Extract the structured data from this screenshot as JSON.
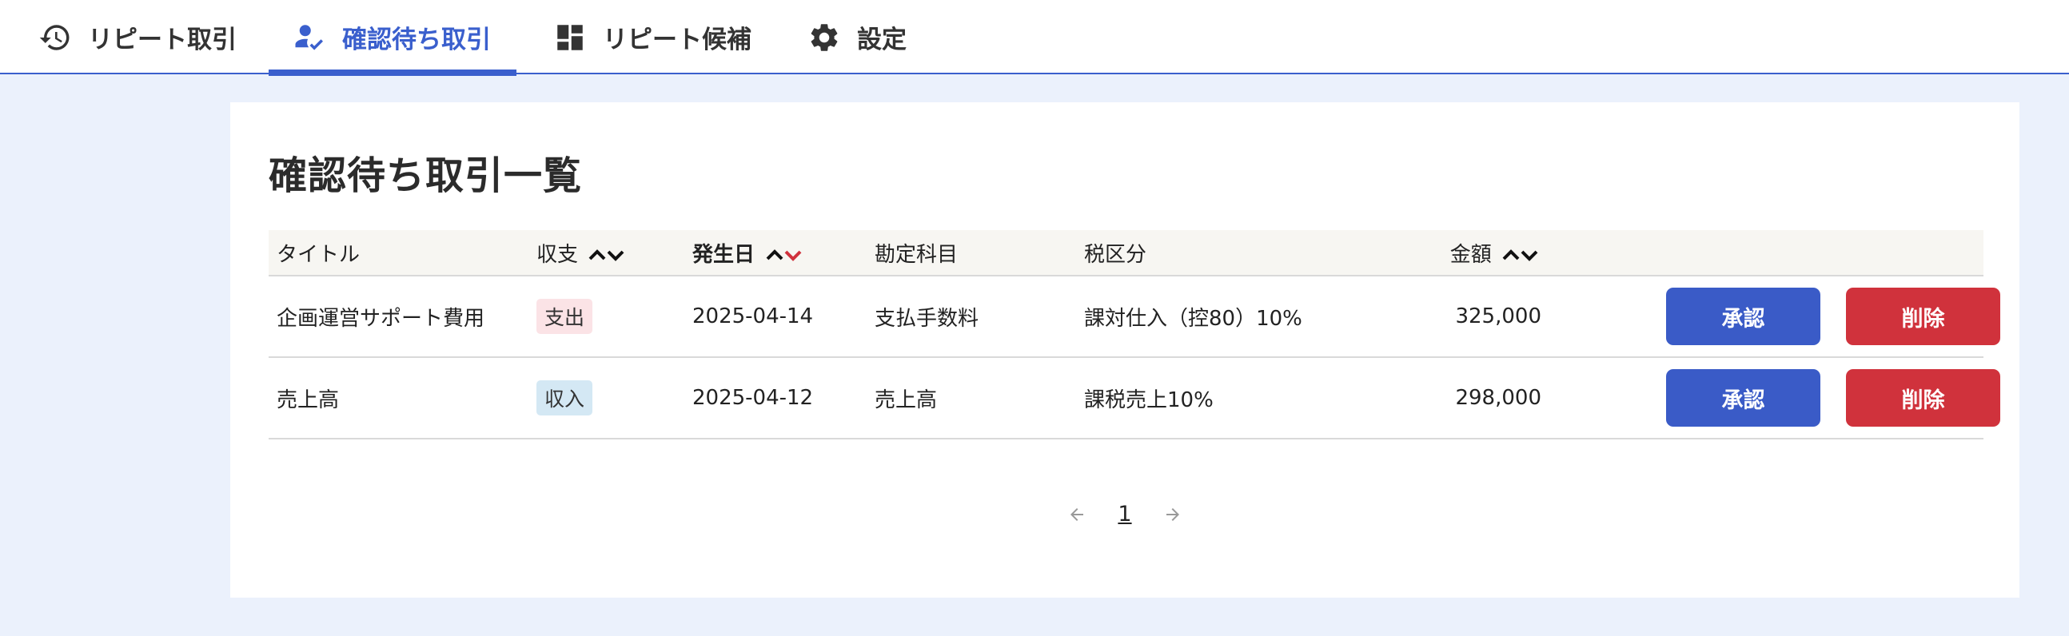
{
  "tabs": [
    {
      "label": "リピート取引",
      "icon": "history-icon",
      "active": false
    },
    {
      "label": "確認待ち取引",
      "icon": "user-check-icon",
      "active": true
    },
    {
      "label": "リピート候補",
      "icon": "dashboard-icon",
      "active": false
    },
    {
      "label": "設定",
      "icon": "gear-icon",
      "active": false
    }
  ],
  "page": {
    "title": "確認待ち取引一覧"
  },
  "table": {
    "headers": {
      "title": "タイトル",
      "type": "収支",
      "date": "発生日",
      "account": "勘定科目",
      "tax": "税区分",
      "amount": "金額"
    },
    "sorted_column": "発生日",
    "sorted_direction": "descending",
    "rows": [
      {
        "title": "企画運営サポート費用",
        "type": "支出",
        "date": "2025-04-14",
        "account": "支払手数料",
        "tax": "課対仕入（控80）10%",
        "amount": "325,000"
      },
      {
        "title": "売上高",
        "type": "収入",
        "date": "2025-04-12",
        "account": "売上高",
        "tax": "課税売上10%",
        "amount": "298,000"
      }
    ],
    "approve_label": "承認",
    "delete_label": "削除"
  },
  "pagination": {
    "current": "1"
  },
  "colors": {
    "accent": "#3a5fcd",
    "approve": "#3a5bc7",
    "delete": "#d0323c",
    "expense_badge": "#fbe3e6",
    "income_badge": "#d4e8f4",
    "sort_active": "#d0323c",
    "background": "#ebf1fc"
  }
}
